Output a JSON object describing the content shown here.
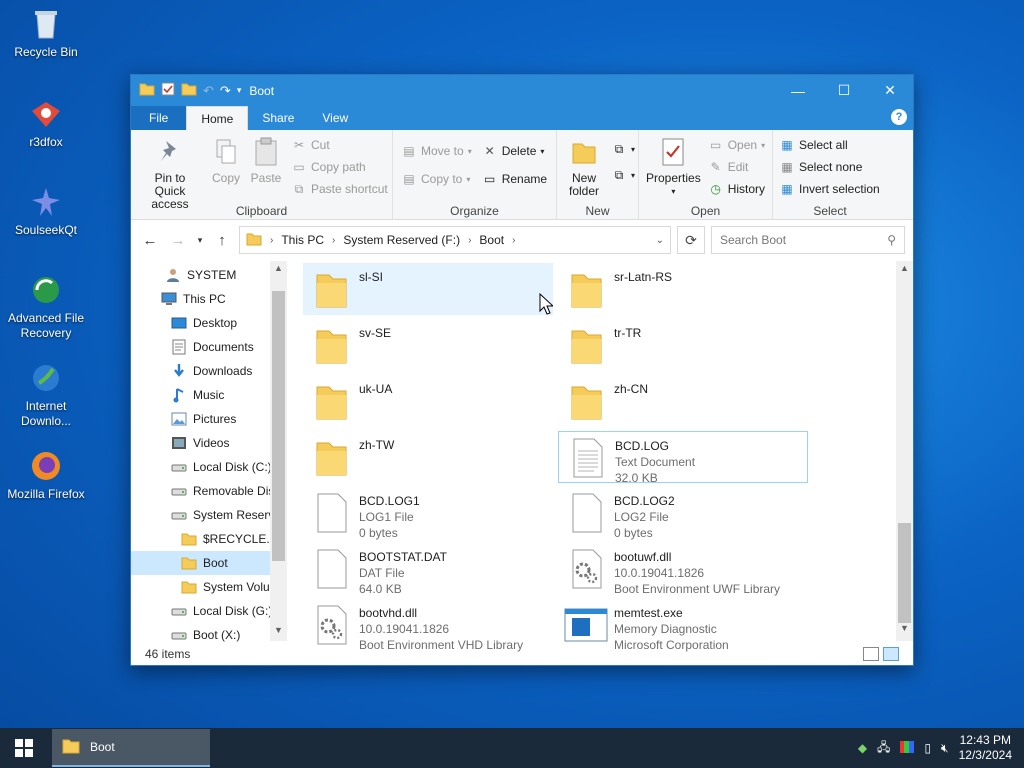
{
  "desktop": {
    "icons": [
      {
        "label": "Recycle Bin",
        "icon": "recycle-bin-icon"
      },
      {
        "label": "r3dfox",
        "icon": "r3dfox-icon"
      },
      {
        "label": "SoulseekQt",
        "icon": "soulseek-icon"
      },
      {
        "label": "Advanced File Recovery",
        "icon": "file-recovery-icon"
      },
      {
        "label": "Internet Downlo...",
        "icon": "internet-download-icon"
      },
      {
        "label": "Mozilla Firefox",
        "icon": "firefox-icon"
      }
    ]
  },
  "window": {
    "title": "Boot",
    "controls": {
      "minimize": "—",
      "maximize": "☐",
      "close": "✕"
    },
    "tabs": [
      "File",
      "Home",
      "Share",
      "View"
    ],
    "help": "?",
    "ribbon": {
      "clipboard": {
        "label": "Clipboard",
        "pin": "Pin to Quick access",
        "copy": "Copy",
        "paste": "Paste",
        "cut": "Cut",
        "copy_path": "Copy path",
        "paste_shortcut": "Paste shortcut"
      },
      "organize": {
        "label": "Organize",
        "move_to": "Move to",
        "copy_to": "Copy to",
        "delete": "Delete",
        "rename": "Rename"
      },
      "new": {
        "label": "New",
        "new_folder": "New folder"
      },
      "open": {
        "label": "Open",
        "properties": "Properties",
        "open": "Open",
        "edit": "Edit",
        "history": "History"
      },
      "select": {
        "label": "Select",
        "select_all": "Select all",
        "select_none": "Select none",
        "invert": "Invert selection"
      }
    },
    "address": {
      "crumbs": [
        "This PC",
        "System Reserved (F:)",
        "Boot"
      ],
      "search_placeholder": "Search Boot"
    },
    "nav": [
      {
        "label": "SYSTEM",
        "icon": "user-icon",
        "indent": 0
      },
      {
        "label": "This PC",
        "icon": "computer-icon",
        "indent": 0
      },
      {
        "label": "Desktop",
        "icon": "desktop-icon",
        "indent": 1
      },
      {
        "label": "Documents",
        "icon": "documents-icon",
        "indent": 1
      },
      {
        "label": "Downloads",
        "icon": "downloads-icon",
        "indent": 1
      },
      {
        "label": "Music",
        "icon": "music-icon",
        "indent": 1
      },
      {
        "label": "Pictures",
        "icon": "pictures-icon",
        "indent": 1
      },
      {
        "label": "Videos",
        "icon": "videos-icon",
        "indent": 1
      },
      {
        "label": "Local Disk (C:)",
        "icon": "drive-icon",
        "indent": 1
      },
      {
        "label": "Removable Dis",
        "icon": "drive-icon",
        "indent": 1
      },
      {
        "label": "System Reserve",
        "icon": "drive-icon",
        "indent": 1
      },
      {
        "label": "$RECYCLE.BIN",
        "icon": "folder-icon",
        "indent": 2
      },
      {
        "label": "Boot",
        "icon": "folder-icon",
        "indent": 2,
        "selected": true
      },
      {
        "label": "System Volun",
        "icon": "folder-icon",
        "indent": 2
      },
      {
        "label": "Local Disk (G:)",
        "icon": "drive-icon",
        "indent": 1
      },
      {
        "label": "Boot (X:)",
        "icon": "drive-icon",
        "indent": 1
      }
    ],
    "files": [
      {
        "name": "sl-SI",
        "type": "folder",
        "line2": "",
        "line3": "",
        "state": "hover"
      },
      {
        "name": "sr-Latn-RS",
        "type": "folder",
        "line2": "",
        "line3": ""
      },
      {
        "name": "sv-SE",
        "type": "folder",
        "line2": "",
        "line3": ""
      },
      {
        "name": "tr-TR",
        "type": "folder",
        "line2": "",
        "line3": ""
      },
      {
        "name": "uk-UA",
        "type": "folder",
        "line2": "",
        "line3": ""
      },
      {
        "name": "zh-CN",
        "type": "folder",
        "line2": "",
        "line3": ""
      },
      {
        "name": "zh-TW",
        "type": "folder",
        "line2": "",
        "line3": ""
      },
      {
        "name": "BCD.LOG",
        "type": "text",
        "line2": "Text Document",
        "line3": "32.0 KB",
        "state": "selected"
      },
      {
        "name": "BCD.LOG1",
        "type": "file",
        "line2": "LOG1 File",
        "line3": "0 bytes"
      },
      {
        "name": "BCD.LOG2",
        "type": "file",
        "line2": "LOG2 File",
        "line3": "0 bytes"
      },
      {
        "name": "BOOTSTAT.DAT",
        "type": "file",
        "line2": "DAT File",
        "line3": "64.0 KB"
      },
      {
        "name": "bootuwf.dll",
        "type": "dll",
        "line2": "10.0.19041.1826",
        "line3": "Boot Environment UWF Library"
      },
      {
        "name": "bootvhd.dll",
        "type": "dll",
        "line2": "10.0.19041.1826",
        "line3": "Boot Environment VHD Library"
      },
      {
        "name": "memtest.exe",
        "type": "exe",
        "line2": "Memory Diagnostic",
        "line3": "Microsoft Corporation"
      }
    ],
    "status": "46 items"
  },
  "taskbar": {
    "app_label": "Boot",
    "time": "12:43 PM",
    "date": "12/3/2024"
  },
  "colors": {
    "titlebar": "#2b8ad8",
    "folder": "#f5cc5a",
    "selection": "#cce8ff"
  }
}
